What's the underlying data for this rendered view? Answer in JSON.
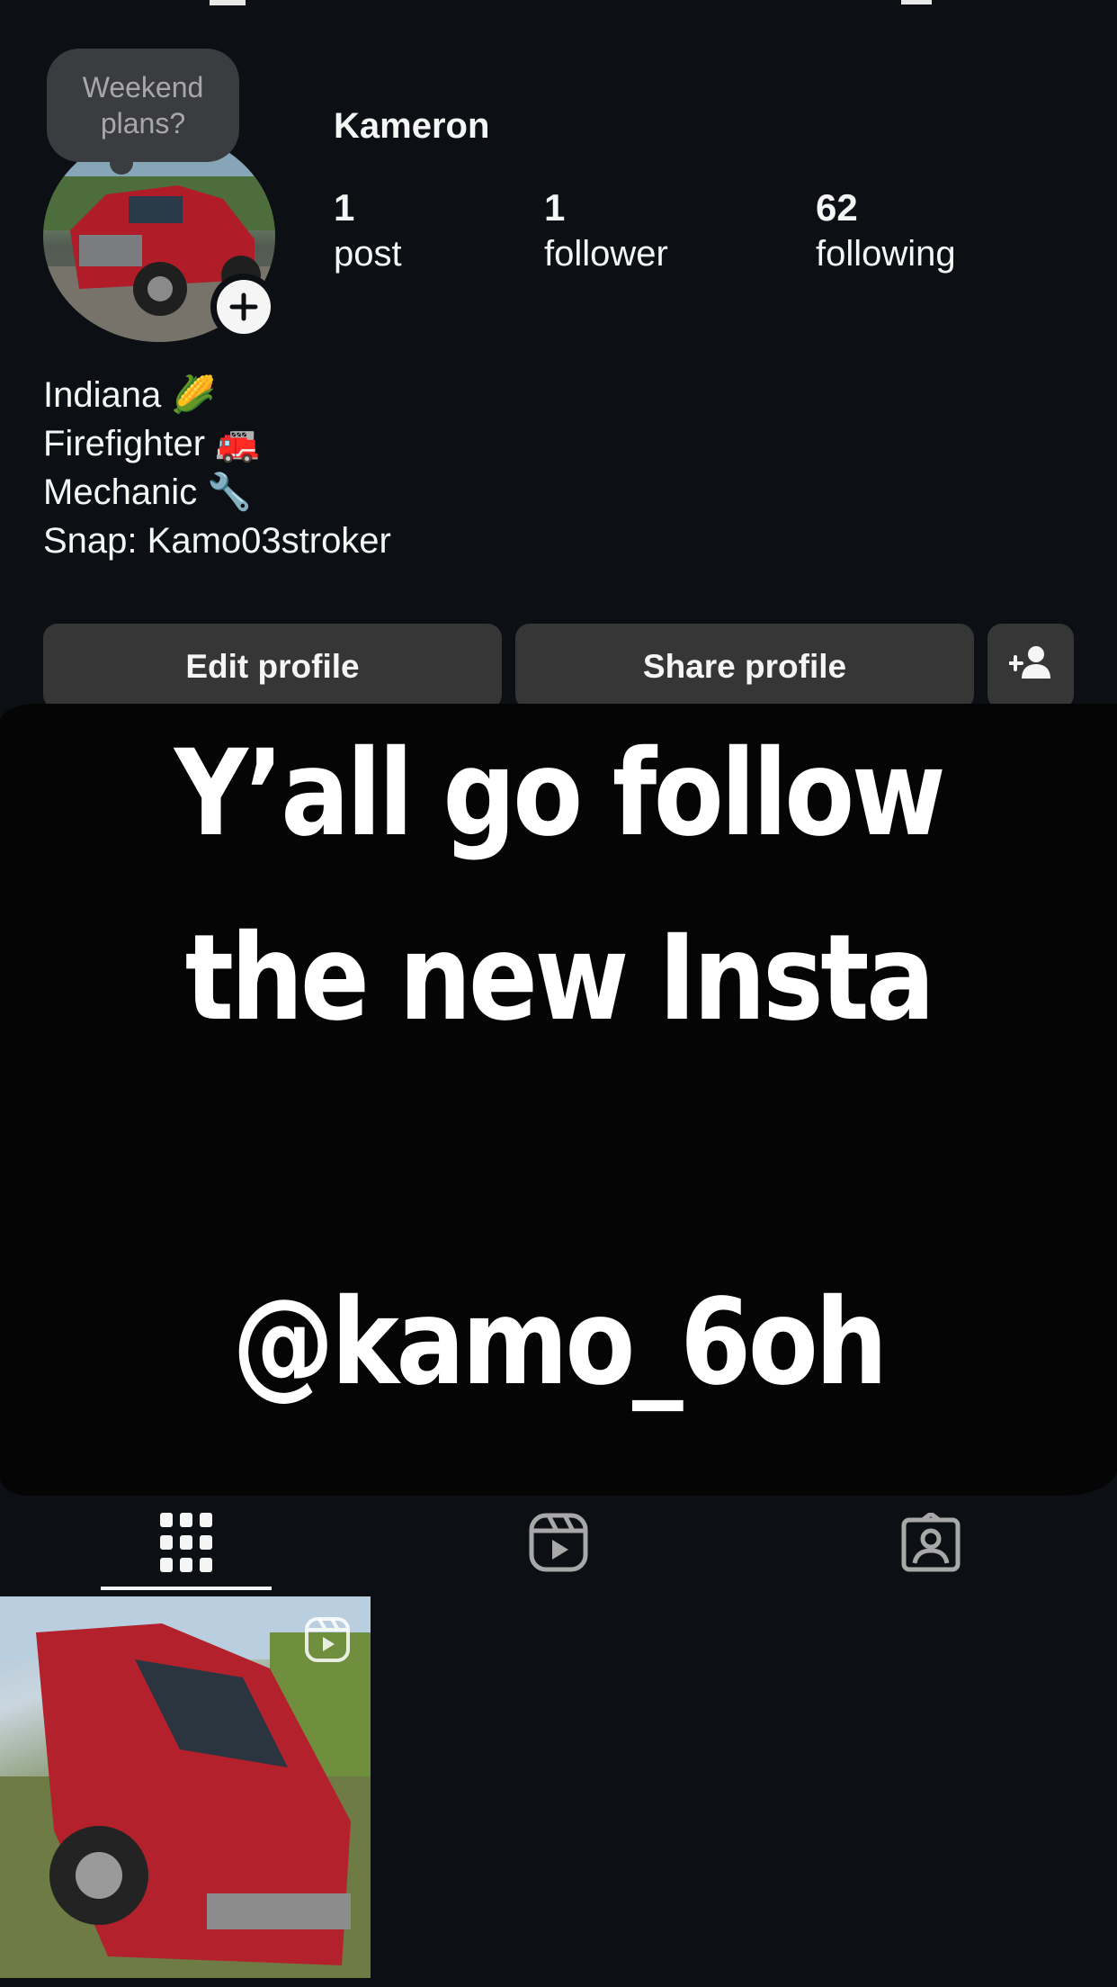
{
  "profile": {
    "note": "Weekend plans?",
    "username": "Kameron",
    "stats": [
      {
        "value": "1",
        "label": "post"
      },
      {
        "value": "1",
        "label": "follower"
      },
      {
        "value": "62",
        "label": "following"
      }
    ],
    "bio": [
      "Indiana 🌽",
      "Firefighter 🚒",
      "Mechanic 🔧",
      "Snap: Kamo03stroker"
    ]
  },
  "actions": {
    "edit_profile": "Edit profile",
    "share_profile": "Share profile",
    "discover_people_icon": "person-add-icon"
  },
  "overlay_text": {
    "line1": "Y’all go follow",
    "line2": "the new Insta",
    "handle": "@kamo_6oh"
  },
  "tabs": [
    {
      "icon": "grid-icon",
      "active": true
    },
    {
      "icon": "reels-icon",
      "active": false
    },
    {
      "icon": "tagged-icon",
      "active": false
    }
  ],
  "posts": [
    {
      "type": "reel",
      "icon": "reel-badge-icon"
    }
  ],
  "colors": {
    "background": "#0c1014",
    "button": "#363636",
    "overlay": "#050505",
    "text": "#f5f5f5"
  }
}
